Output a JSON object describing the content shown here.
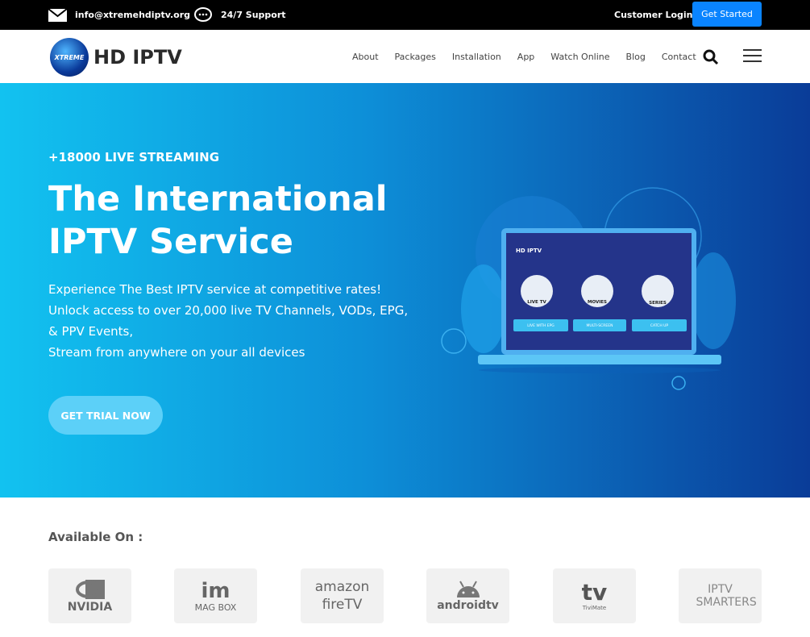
{
  "topbar": {
    "email": "info@xtremehdiptv.org",
    "support": "24/7 Support",
    "login": "Customer Login",
    "get_started": "Get Started"
  },
  "nav": {
    "logo_badge": "XTREME",
    "logo_text": "HD IPTV",
    "items": [
      "About",
      "Packages",
      "Installation",
      "App",
      "Watch Online",
      "Blog",
      "Contact"
    ]
  },
  "hero": {
    "subtitle": "+18000 LIVE STREAMING",
    "title_line1": "The International",
    "title_line2": "IPTV Service",
    "lines": [
      "Experience The Best IPTV service at competitive rates!",
      "Unlock access to over 20,000 live TV Channels, VODs, EPG,",
      "& PPV Events,",
      "Stream from anywhere on your all devices"
    ],
    "cta": "GET TRIAL NOW",
    "screen": {
      "brand": "HD IPTV",
      "tiles": [
        "LIVE TV",
        "MOVIES",
        "SERIES"
      ],
      "buttons": [
        "LIVE WITH EPG",
        "MULTI-SCREEN",
        "CATCH UP"
      ]
    }
  },
  "available": {
    "title": "Available On :",
    "platforms": [
      "NVIDIA",
      "MAG BOX",
      "amazon fireTV",
      "androidtv",
      "TiviMate",
      "IPTV SMARTERS"
    ]
  },
  "colors": {
    "accent": "#0a84ff",
    "hero_start": "#12c2f0",
    "hero_end": "#0a3c98",
    "cta": "#5cd0f8"
  }
}
